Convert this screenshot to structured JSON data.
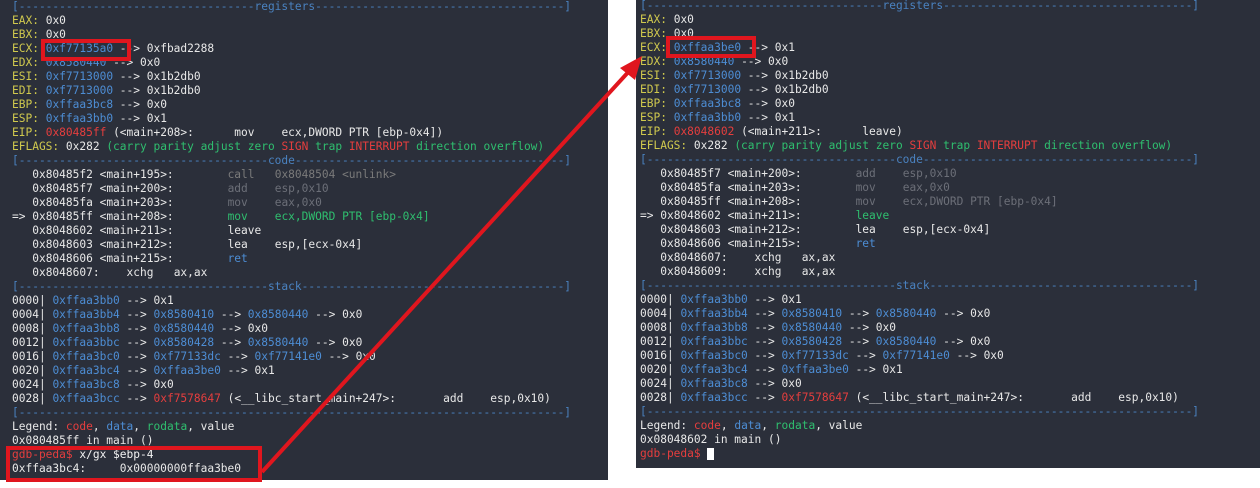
{
  "left": {
    "sep_registers": "[-----------------------------------registers-------------------------------------]",
    "regs": [
      {
        "name": "EAX:",
        "value": "0x0",
        "chain": ""
      },
      {
        "name": "EBX:",
        "value": "0x0",
        "chain": ""
      },
      {
        "name": "ECX:",
        "value": "0xf77135a0",
        "chain": " --> 0xfbad2288"
      },
      {
        "name": "EDX:",
        "value": "0x8580440",
        "chain": " --> 0x0"
      },
      {
        "name": "ESI:",
        "value": "0xf7713000",
        "chain": " --> 0x1b2db0"
      },
      {
        "name": "EDI:",
        "value": "0xf7713000",
        "chain": " --> 0x1b2db0"
      },
      {
        "name": "EBP:",
        "value": "0xffaa3bc8",
        "chain": " --> 0x0"
      },
      {
        "name": "ESP:",
        "value": "0xffaa3bb0",
        "chain": " --> 0x1"
      }
    ],
    "eip": {
      "name": "EIP:",
      "addr": "0x80485ff",
      "rest": " (<main+208>:      mov    ecx,DWORD PTR [ebp-0x4])"
    },
    "eflags": {
      "name": "EFLAGS:",
      "val": " 0x282 ",
      "open": "(carry parity adjust zero ",
      "sign": "SIGN",
      "trap": " trap ",
      "interrupt": "INTERRUPT",
      "close": " direction overflow)"
    },
    "sep_code": "[-------------------------------------code----------------------------------------]",
    "code": [
      {
        "prefix": "   ",
        "addr": "0x80485f2",
        "sym": " <main+195>:",
        "pad": "        ",
        "ins": "call   0x8048504 <unlink>",
        "style": "strike"
      },
      {
        "prefix": "   ",
        "addr": "0x80485f7",
        "sym": " <main+200>:",
        "pad": "        ",
        "ins": "add    esp,0x10",
        "style": "dim"
      },
      {
        "prefix": "   ",
        "addr": "0x80485fa",
        "sym": " <main+203>:",
        "pad": "        ",
        "ins": "mov    eax,0x0",
        "style": "dim"
      },
      {
        "prefix": "=> ",
        "addr": "0x80485ff",
        "sym": " <main+208>:",
        "pad": "        ",
        "ins": "mov    ecx,DWORD PTR [ebp-0x4]",
        "style": "current"
      },
      {
        "prefix": "   ",
        "addr": "0x8048602",
        "sym": " <main+211>:",
        "pad": "        ",
        "ins": "leave",
        "style": "normal"
      },
      {
        "prefix": "   ",
        "addr": "0x8048603",
        "sym": " <main+212>:",
        "pad": "        ",
        "ins": "lea    esp,[ecx-0x4]",
        "style": "normal"
      },
      {
        "prefix": "   ",
        "addr": "0x8048606",
        "sym": " <main+215>:",
        "pad": "        ",
        "ins": "ret",
        "style": "ret"
      },
      {
        "prefix": "   ",
        "addr": "0x8048607",
        "sym": ":",
        "pad": "    ",
        "ins": "xchg   ax,ax",
        "style": "normal"
      }
    ],
    "sep_stack": "[-------------------------------------stack---------------------------------------]",
    "stack": [
      {
        "off": "0000|",
        "addr": "0xffaa3bb0",
        "chain": [
          {
            "t": " --> "
          },
          {
            "t": "0x1",
            "c": "val"
          }
        ]
      },
      {
        "off": "0004|",
        "addr": "0xffaa3bb4",
        "chain": [
          {
            "t": " --> "
          },
          {
            "t": "0x8580410",
            "c": "addr"
          },
          {
            "t": " --> "
          },
          {
            "t": "0x8580440",
            "c": "addr"
          },
          {
            "t": " --> 0x0"
          }
        ]
      },
      {
        "off": "0008|",
        "addr": "0xffaa3bb8",
        "chain": [
          {
            "t": " --> "
          },
          {
            "t": "0x8580440",
            "c": "addr"
          },
          {
            "t": " --> 0x0"
          }
        ]
      },
      {
        "off": "0012|",
        "addr": "0xffaa3bbc",
        "chain": [
          {
            "t": " --> "
          },
          {
            "t": "0x8580428",
            "c": "addr"
          },
          {
            "t": " --> "
          },
          {
            "t": "0x8580440",
            "c": "addr"
          },
          {
            "t": " --> 0x0"
          }
        ]
      },
      {
        "off": "0016|",
        "addr": "0xffaa3bc0",
        "chain": [
          {
            "t": " --> "
          },
          {
            "t": "0xf77133dc",
            "c": "addr"
          },
          {
            "t": " --> "
          },
          {
            "t": "0xf77141e0",
            "c": "addr"
          },
          {
            "t": " --> 0x0"
          }
        ]
      },
      {
        "off": "0020|",
        "addr": "0xffaa3bc4",
        "chain": [
          {
            "t": " --> "
          },
          {
            "t": "0xffaa3be0",
            "c": "addr"
          },
          {
            "t": " --> 0x1"
          }
        ]
      },
      {
        "off": "0024|",
        "addr": "0xffaa3bc8",
        "chain": [
          {
            "t": " --> 0x0"
          }
        ]
      },
      {
        "off": "0028|",
        "addr": "0xffaa3bcc",
        "chain": [
          {
            "t": " --> "
          },
          {
            "t": "0xf7578647",
            "c": "code"
          },
          {
            "t": " (<__libc_start_main+247>:       add    esp,0x10)"
          }
        ]
      }
    ],
    "sep_end": "[---------------------------------------------------------------------------------]",
    "legend": {
      "label": "Legend: ",
      "code": "code",
      "sep1": ", ",
      "data": "data",
      "sep2": ", ",
      "rodata": "rodata",
      "sep3": ", ",
      "value": "value"
    },
    "where": "0x080485ff in main ()",
    "prompt1": "gdb-peda$",
    "cmd1": " x/gx $ebp-4",
    "out_addr": "0xffaa3bc4:",
    "out_val": "     0x00000000ffaa3be0"
  },
  "right": {
    "sep_registers": "[-----------------------------------registers-------------------------------------]",
    "regs": [
      {
        "name": "EAX:",
        "value": "0x0",
        "chain": ""
      },
      {
        "name": "EBX:",
        "value": "0x0",
        "chain": ""
      },
      {
        "name": "ECX:",
        "value": "0xffaa3be0",
        "chain": " --> 0x1"
      },
      {
        "name": "EDX:",
        "value": "0x8580440",
        "chain": " --> 0x0"
      },
      {
        "name": "ESI:",
        "value": "0xf7713000",
        "chain": " --> 0x1b2db0"
      },
      {
        "name": "EDI:",
        "value": "0xf7713000",
        "chain": " --> 0x1b2db0"
      },
      {
        "name": "EBP:",
        "value": "0xffaa3bc8",
        "chain": " --> 0x0"
      },
      {
        "name": "ESP:",
        "value": "0xffaa3bb0",
        "chain": " --> 0x1"
      }
    ],
    "eip": {
      "name": "EIP:",
      "addr": "0x8048602",
      "rest": " (<main+211>:      leave)"
    },
    "eflags": {
      "name": "EFLAGS:",
      "val": " 0x282 ",
      "open": "(carry parity adjust zero ",
      "sign": "SIGN",
      "trap": " trap ",
      "interrupt": "INTERRUPT",
      "close": " direction overflow)"
    },
    "sep_code": "[-------------------------------------code----------------------------------------]",
    "code": [
      {
        "prefix": "   ",
        "addr": "0x80485f7",
        "sym": " <main+200>:",
        "pad": "        ",
        "ins": "add    esp,0x10",
        "style": "dim"
      },
      {
        "prefix": "   ",
        "addr": "0x80485fa",
        "sym": " <main+203>:",
        "pad": "        ",
        "ins": "mov    eax,0x0",
        "style": "dim"
      },
      {
        "prefix": "   ",
        "addr": "0x80485ff",
        "sym": " <main+208>:",
        "pad": "        ",
        "ins": "mov    ecx,DWORD PTR [ebp-0x4]",
        "style": "dim"
      },
      {
        "prefix": "=> ",
        "addr": "0x8048602",
        "sym": " <main+211>:",
        "pad": "        ",
        "ins": "leave",
        "style": "current"
      },
      {
        "prefix": "   ",
        "addr": "0x8048603",
        "sym": " <main+212>:",
        "pad": "        ",
        "ins": "lea    esp,[ecx-0x4]",
        "style": "normal"
      },
      {
        "prefix": "   ",
        "addr": "0x8048606",
        "sym": " <main+215>:",
        "pad": "        ",
        "ins": "ret",
        "style": "ret"
      },
      {
        "prefix": "   ",
        "addr": "0x8048607",
        "sym": ":",
        "pad": "    ",
        "ins": "xchg   ax,ax",
        "style": "normal"
      },
      {
        "prefix": "   ",
        "addr": "0x8048609",
        "sym": ":",
        "pad": "    ",
        "ins": "xchg   ax,ax",
        "style": "normal"
      }
    ],
    "sep_stack": "[-------------------------------------stack---------------------------------------]",
    "stack": [
      {
        "off": "0000|",
        "addr": "0xffaa3bb0",
        "chain": [
          {
            "t": " --> "
          },
          {
            "t": "0x1",
            "c": "val"
          }
        ]
      },
      {
        "off": "0004|",
        "addr": "0xffaa3bb4",
        "chain": [
          {
            "t": " --> "
          },
          {
            "t": "0x8580410",
            "c": "addr"
          },
          {
            "t": " --> "
          },
          {
            "t": "0x8580440",
            "c": "addr"
          },
          {
            "t": " --> 0x0"
          }
        ]
      },
      {
        "off": "0008|",
        "addr": "0xffaa3bb8",
        "chain": [
          {
            "t": " --> "
          },
          {
            "t": "0x8580440",
            "c": "addr"
          },
          {
            "t": " --> 0x0"
          }
        ]
      },
      {
        "off": "0012|",
        "addr": "0xffaa3bbc",
        "chain": [
          {
            "t": " --> "
          },
          {
            "t": "0x8580428",
            "c": "addr"
          },
          {
            "t": " --> "
          },
          {
            "t": "0x8580440",
            "c": "addr"
          },
          {
            "t": " --> 0x0"
          }
        ]
      },
      {
        "off": "0016|",
        "addr": "0xffaa3bc0",
        "chain": [
          {
            "t": " --> "
          },
          {
            "t": "0xf77133dc",
            "c": "addr"
          },
          {
            "t": " --> "
          },
          {
            "t": "0xf77141e0",
            "c": "addr"
          },
          {
            "t": " --> 0x0"
          }
        ]
      },
      {
        "off": "0020|",
        "addr": "0xffaa3bc4",
        "chain": [
          {
            "t": " --> "
          },
          {
            "t": "0xffaa3be0",
            "c": "addr"
          },
          {
            "t": " --> 0x1"
          }
        ]
      },
      {
        "off": "0024|",
        "addr": "0xffaa3bc8",
        "chain": [
          {
            "t": " --> 0x0"
          }
        ]
      },
      {
        "off": "0028|",
        "addr": "0xffaa3bcc",
        "chain": [
          {
            "t": " --> "
          },
          {
            "t": "0xf7578647",
            "c": "code"
          },
          {
            "t": " (<__libc_start_main+247>:       add    esp,0x10)"
          }
        ]
      }
    ],
    "sep_end": "[---------------------------------------------------------------------------------]",
    "legend": {
      "label": "Legend: ",
      "code": "code",
      "sep1": ", ",
      "data": "data",
      "sep2": ", ",
      "rodata": "rodata",
      "sep3": ", ",
      "value": "value"
    },
    "where": "0x08048602 in main ()",
    "prompt1": "gdb-peda$"
  },
  "colors": {
    "terminal_bg": "#2b2f3a",
    "annotation": "#e0161e"
  }
}
